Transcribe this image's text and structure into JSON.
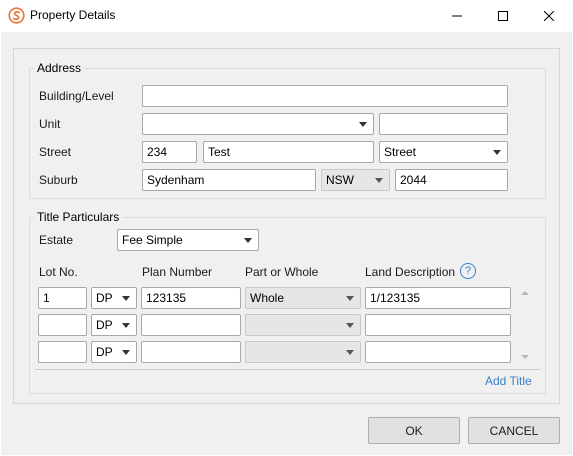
{
  "window": {
    "title": "Property Details"
  },
  "address": {
    "group_label": "Address",
    "labels": {
      "building": "Building/Level",
      "unit": "Unit",
      "street": "Street",
      "suburb": "Suburb"
    },
    "building_value": "",
    "unit_type_value": "",
    "unit_value": "",
    "street_number": "234",
    "street_name": "Test",
    "street_type": "Street",
    "suburb": "Sydenham",
    "state": "NSW",
    "postcode": "2044"
  },
  "title": {
    "group_label": "Title Particulars",
    "estate_label": "Estate",
    "estate_value": "Fee Simple",
    "columns": {
      "lot": "Lot No.",
      "plan": "Plan Number",
      "part": "Part or Whole",
      "desc": "Land Description"
    },
    "rows": [
      {
        "lot": "1",
        "plan_type": "DP",
        "plan": "123135",
        "part": "Whole",
        "desc": "1/123135"
      },
      {
        "lot": "",
        "plan_type": "DP",
        "plan": "",
        "part": "",
        "desc": ""
      },
      {
        "lot": "",
        "plan_type": "DP",
        "plan": "",
        "part": "",
        "desc": ""
      }
    ],
    "add_title": "Add Title",
    "help_glyph": "?"
  },
  "footer": {
    "ok": "OK",
    "cancel": "CANCEL"
  },
  "icons": {
    "app": "app-logo-icon",
    "minimize": "minimize-icon",
    "maximize": "maximize-icon",
    "close": "close-icon",
    "help": "help-icon"
  },
  "colors": {
    "accent": "#3c7fc7",
    "app_icon": "#e8753a"
  }
}
